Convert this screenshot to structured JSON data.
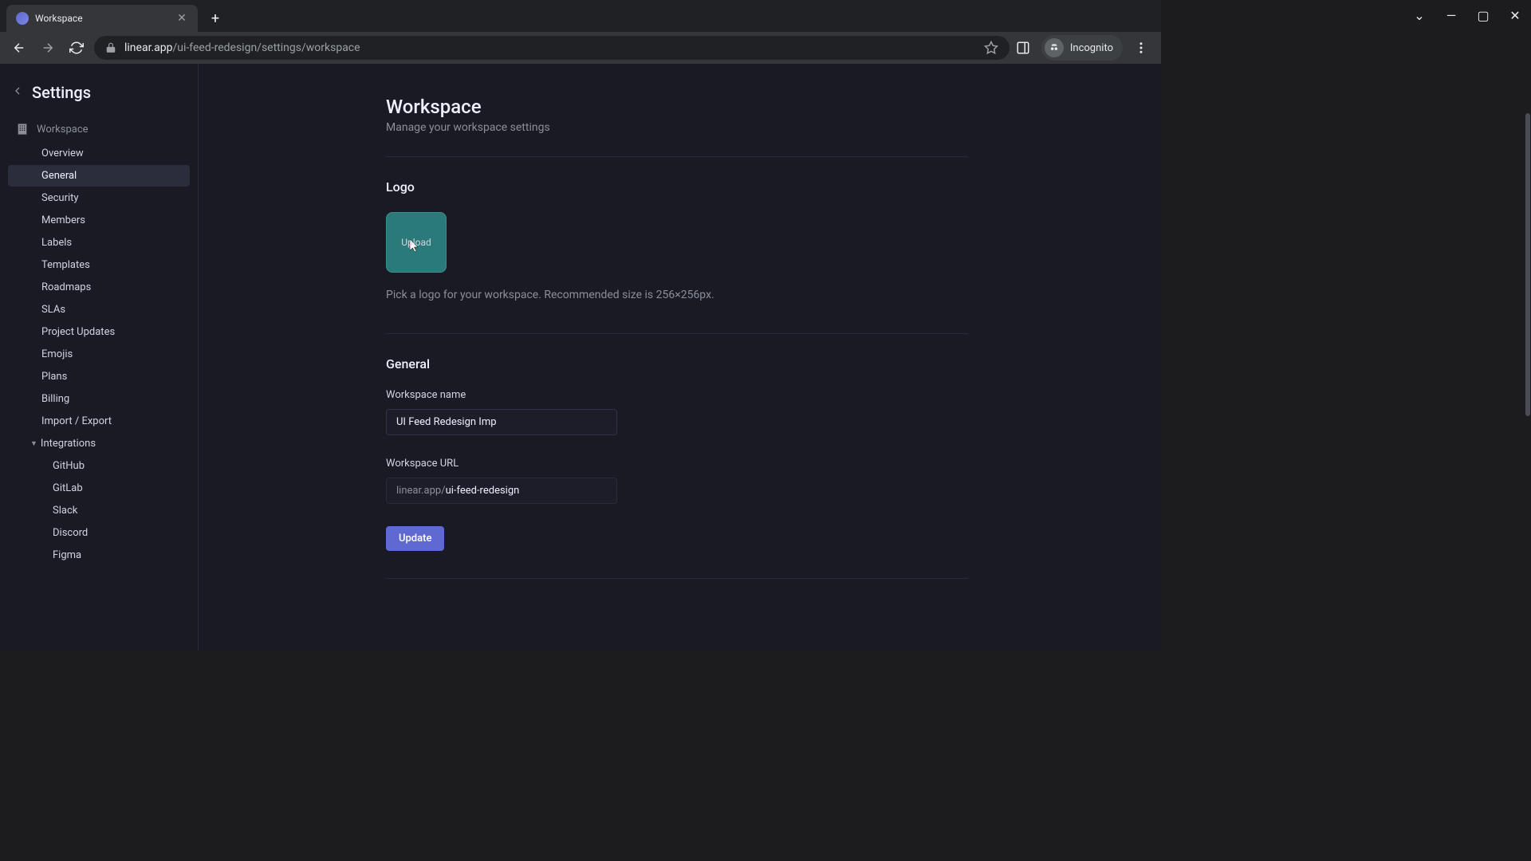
{
  "browser": {
    "tab_title": "Workspace",
    "url_host": "linear.app",
    "url_path": "/ui-feed-redesign/settings/workspace",
    "incognito_label": "Incognito"
  },
  "sidebar": {
    "title": "Settings",
    "section_label": "Workspace",
    "items": [
      {
        "label": "Overview"
      },
      {
        "label": "General"
      },
      {
        "label": "Security"
      },
      {
        "label": "Members"
      },
      {
        "label": "Labels"
      },
      {
        "label": "Templates"
      },
      {
        "label": "Roadmaps"
      },
      {
        "label": "SLAs"
      },
      {
        "label": "Project Updates"
      },
      {
        "label": "Emojis"
      },
      {
        "label": "Plans"
      },
      {
        "label": "Billing"
      },
      {
        "label": "Import / Export"
      }
    ],
    "expandable": {
      "label": "Integrations"
    },
    "subitems": [
      {
        "label": "GitHub"
      },
      {
        "label": "GitLab"
      },
      {
        "label": "Slack"
      },
      {
        "label": "Discord"
      },
      {
        "label": "Figma"
      }
    ]
  },
  "main": {
    "title": "Workspace",
    "subtitle": "Manage your workspace settings",
    "logo_section": {
      "heading": "Logo",
      "upload_label": "Upload",
      "hint": "Pick a logo for your workspace. Recommended size is 256×256px."
    },
    "general_section": {
      "heading": "General",
      "name_label": "Workspace name",
      "name_value": "UI Feed Redesign Imp",
      "url_label": "Workspace URL",
      "url_prefix": "linear.app/",
      "url_value": "ui-feed-redesign",
      "update_button": "Update"
    }
  }
}
